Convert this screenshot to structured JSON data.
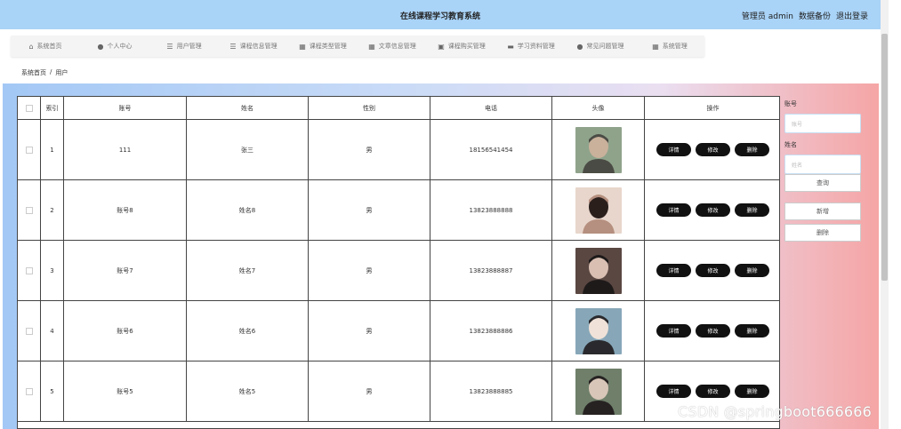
{
  "header": {
    "title": "在线课程学习教育系统",
    "admin_label": "管理员 admin",
    "backup_label": "数据备份",
    "logout_label": "退出登录"
  },
  "nav": {
    "items": [
      {
        "icon": "home-icon",
        "label": "系统首页"
      },
      {
        "icon": "user-icon",
        "label": "个人中心"
      },
      {
        "icon": "users-icon",
        "label": "用户管理"
      },
      {
        "icon": "list-icon",
        "label": "课程信息管理"
      },
      {
        "icon": "grid-icon",
        "label": "课程类型管理"
      },
      {
        "icon": "table-icon",
        "label": "文章信息管理"
      },
      {
        "icon": "book-icon",
        "label": "课程购买管理"
      },
      {
        "icon": "folder-icon",
        "label": "学习资料管理"
      },
      {
        "icon": "question-icon",
        "label": "常见问题管理"
      },
      {
        "icon": "settings-icon",
        "label": "系统管理"
      }
    ]
  },
  "breadcrumb": {
    "home": "系统首页",
    "separator": "/",
    "current": "用户"
  },
  "table": {
    "columns": [
      "索引",
      "账号",
      "姓名",
      "性别",
      "电话",
      "头像",
      "操作"
    ],
    "rows": [
      {
        "index": "1",
        "account": "111",
        "name": "张三",
        "gender": "男",
        "phone": "18156541454",
        "avatar_colors": [
          "#8fa38b",
          "#c9b19b",
          "#4b4b45"
        ]
      },
      {
        "index": "2",
        "account": "账号8",
        "name": "姓名8",
        "gender": "男",
        "phone": "13823888888",
        "avatar_colors": [
          "#e8d6cc",
          "#2b1f1c",
          "#b58f7f"
        ]
      },
      {
        "index": "3",
        "account": "账号7",
        "name": "姓名7",
        "gender": "男",
        "phone": "13823888887",
        "avatar_colors": [
          "#5a4742",
          "#d9bfb2",
          "#1e1a1a"
        ]
      },
      {
        "index": "4",
        "account": "账号6",
        "name": "姓名6",
        "gender": "男",
        "phone": "13823888886",
        "avatar_colors": [
          "#87a7b8",
          "#f0e2d8",
          "#2a2a2e"
        ]
      },
      {
        "index": "5",
        "account": "账号5",
        "name": "姓名5",
        "gender": "男",
        "phone": "13823888885",
        "avatar_colors": [
          "#6f7f6a",
          "#d8c6b8",
          "#272222"
        ]
      }
    ],
    "actions": {
      "detail": "详情",
      "edit": "修改",
      "delete": "删除"
    }
  },
  "search": {
    "account_label": "账号",
    "account_placeholder": "账号",
    "name_label": "姓名",
    "name_placeholder": "姓名",
    "query_button": "查询",
    "add_button": "新增",
    "delete_button": "删除"
  },
  "watermark": "CSDN @springboot666666"
}
